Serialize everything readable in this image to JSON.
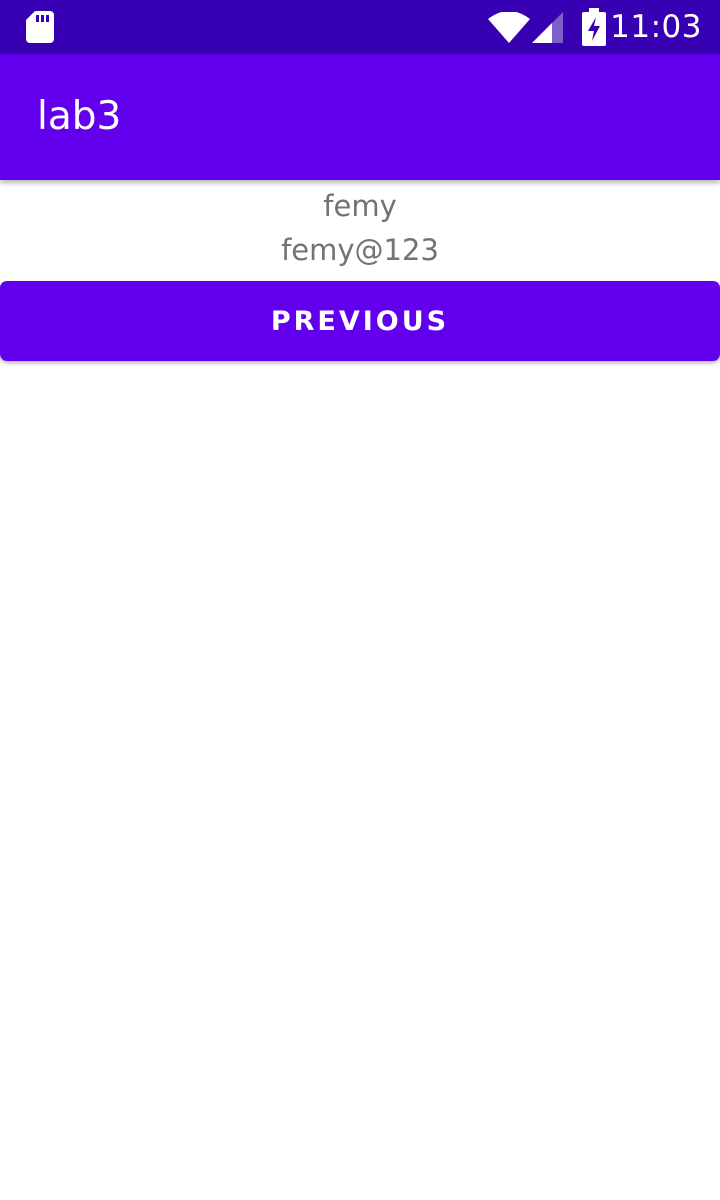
{
  "status_bar": {
    "time": "11:03",
    "icons": [
      "sd-card-icon",
      "wifi-icon",
      "cell-signal-icon",
      "battery-charging-icon"
    ],
    "background": "#3700B3"
  },
  "app_bar": {
    "title": "lab3",
    "background": "#6200EE"
  },
  "content": {
    "username": "femy",
    "password": "femy@123"
  },
  "buttons": {
    "previous_label": "PREVIOUS"
  },
  "colors": {
    "accent": "#6200EE",
    "status_bar": "#3700B3",
    "text_secondary": "#737373"
  }
}
